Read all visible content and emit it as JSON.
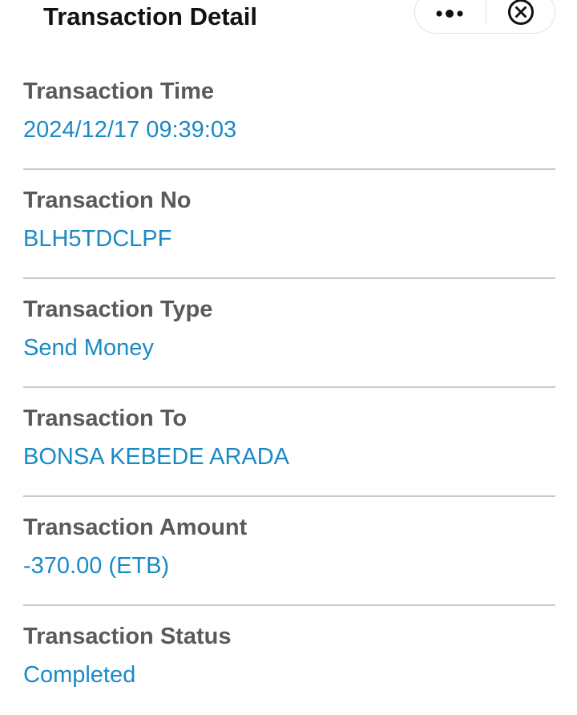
{
  "header": {
    "title": "Transaction Detail",
    "more_icon": "more-horizontal-icon",
    "close_icon": "close-circle-icon"
  },
  "details": [
    {
      "label": "Transaction Time",
      "value": "2024/12/17 09:39:03"
    },
    {
      "label": "Transaction No",
      "value": "BLH5TDCLPF"
    },
    {
      "label": "Transaction Type",
      "value": "Send Money"
    },
    {
      "label": "Transaction To",
      "value": "BONSA KEBEDE ARADA"
    },
    {
      "label": "Transaction Amount",
      "value": "-370.00 (ETB)"
    },
    {
      "label": "Transaction Status",
      "value": "Completed"
    }
  ],
  "colors": {
    "label": "#5a5a5a",
    "value": "#1a8ac6",
    "divider": "#c9c9c9"
  }
}
